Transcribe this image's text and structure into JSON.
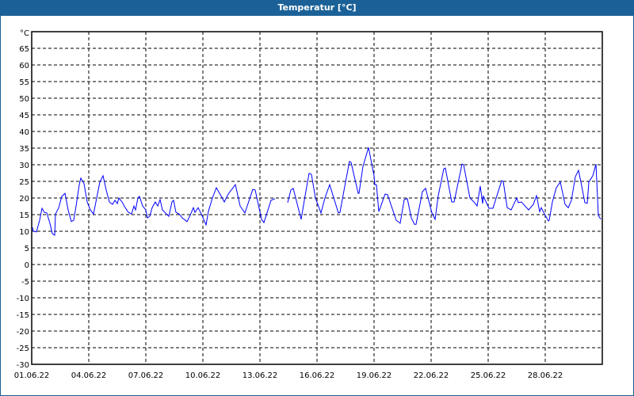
{
  "window": {
    "title": "Temperatur [°C]"
  },
  "chart_data": {
    "type": "line",
    "title": "Temperatur [°C]",
    "ylabel": "°C",
    "xlabel": "",
    "ylim": [
      -30,
      70
    ],
    "y_ticks": [
      -30,
      -25,
      -20,
      -15,
      -10,
      -5,
      0,
      5,
      10,
      15,
      20,
      25,
      30,
      35,
      40,
      45,
      50,
      55,
      60,
      65
    ],
    "x_unit": "hours since 01.06.22 00:00",
    "xlim": [
      0,
      720
    ],
    "x_ticks": [
      {
        "hour": 0,
        "label": "01.06.22"
      },
      {
        "hour": 72,
        "label": "04.06.22"
      },
      {
        "hour": 144,
        "label": "07.06.22"
      },
      {
        "hour": 216,
        "label": "10.06.22"
      },
      {
        "hour": 288,
        "label": "13.06.22"
      },
      {
        "hour": 360,
        "label": "16.06.22"
      },
      {
        "hour": 432,
        "label": "19.06.22"
      },
      {
        "hour": 504,
        "label": "22.06.22"
      },
      {
        "hour": 576,
        "label": "25.06.22"
      },
      {
        "hour": 648,
        "label": "28.06.22"
      }
    ],
    "grid": true,
    "line_color": "#0000ff",
    "series": [
      {
        "name": "Temperatur",
        "segments": [
          [
            [
              1,
              11.2
            ],
            [
              2,
              10.0
            ],
            [
              6,
              9.8
            ],
            [
              10,
              13.3
            ],
            [
              13,
              16.9
            ],
            [
              16,
              15.7
            ],
            [
              19,
              15.5
            ],
            [
              23,
              12.4
            ],
            [
              26,
              9.3
            ],
            [
              29,
              8.8
            ],
            [
              30,
              15.2
            ],
            [
              34,
              17.0
            ],
            [
              38,
              20.5
            ],
            [
              42,
              21.4
            ],
            [
              46,
              16.4
            ],
            [
              50,
              12.9
            ],
            [
              53,
              13.3
            ],
            [
              56,
              17.6
            ],
            [
              60,
              24.0
            ],
            [
              62,
              26.0
            ],
            [
              66,
              24.3
            ],
            [
              70,
              18.8
            ],
            [
              74,
              16.4
            ],
            [
              78,
              15.2
            ],
            [
              82,
              20.0
            ],
            [
              86,
              24.8
            ],
            [
              90,
              26.7
            ],
            [
              94,
              22.4
            ],
            [
              98,
              18.8
            ],
            [
              102,
              18.1
            ],
            [
              105,
              19.3
            ],
            [
              108,
              18.3
            ],
            [
              110,
              20.0
            ],
            [
              114,
              18.8
            ],
            [
              118,
              17.1
            ],
            [
              122,
              15.7
            ],
            [
              126,
              15.2
            ],
            [
              129,
              17.6
            ],
            [
              131,
              16.4
            ],
            [
              134,
              20.0
            ],
            [
              136,
              20.5
            ],
            [
              140,
              17.6
            ],
            [
              144,
              16.4
            ],
            [
              146,
              14.0
            ],
            [
              149,
              14.5
            ],
            [
              152,
              17.1
            ],
            [
              156,
              18.8
            ],
            [
              159,
              17.6
            ],
            [
              162,
              19.5
            ],
            [
              165,
              16.4
            ],
            [
              170,
              15.2
            ],
            [
              173,
              14.5
            ],
            [
              177,
              18.8
            ],
            [
              179,
              19.3
            ],
            [
              182,
              15.7
            ],
            [
              186,
              15.2
            ],
            [
              190,
              14.0
            ],
            [
              196,
              12.9
            ],
            [
              200,
              14.8
            ],
            [
              204,
              17.1
            ],
            [
              206,
              15.7
            ],
            [
              210,
              17.1
            ],
            [
              214,
              15.2
            ],
            [
              217,
              13.6
            ],
            [
              220,
              11.9
            ],
            [
              223,
              16.0
            ],
            [
              228,
              20.0
            ],
            [
              233,
              23.1
            ],
            [
              240,
              20.2
            ],
            [
              243,
              18.8
            ],
            [
              248,
              21.2
            ],
            [
              257,
              24.0
            ],
            [
              263,
              17.6
            ],
            [
              269,
              15.5
            ],
            [
              279,
              22.6
            ],
            [
              282,
              22.4
            ],
            [
              290,
              13.6
            ],
            [
              293,
              12.6
            ],
            [
              302,
              19.3
            ],
            [
              307,
              19.8
            ]
          ],
          [
            [
              323,
              18.6
            ],
            [
              327,
              22.4
            ],
            [
              330,
              22.9
            ],
            [
              340,
              13.6
            ],
            [
              345,
              20.7
            ],
            [
              350,
              27.4
            ],
            [
              353,
              27.1
            ],
            [
              358,
              20.0
            ],
            [
              365,
              15.5
            ],
            [
              370,
              20.0
            ],
            [
              376,
              24.0
            ],
            [
              387,
              15.5
            ],
            [
              389,
              15.7
            ],
            [
              396,
              24.8
            ],
            [
              401,
              31.0
            ],
            [
              403,
              30.7
            ],
            [
              412,
              21.4
            ],
            [
              413,
              21.4
            ],
            [
              418,
              29.5
            ],
            [
              425,
              35.2
            ],
            [
              432,
              26.7
            ],
            [
              433,
              24.0
            ],
            [
              435,
              24.0
            ],
            [
              438,
              15.9
            ],
            [
              446,
              21.2
            ],
            [
              449,
              21.0
            ],
            [
              460,
              13.3
            ],
            [
              465,
              12.4
            ],
            [
              470,
              19.5
            ],
            [
              474,
              19.8
            ],
            [
              479,
              14.0
            ],
            [
              483,
              12.1
            ],
            [
              485,
              12.1
            ],
            [
              493,
              21.9
            ],
            [
              497,
              22.9
            ],
            [
              505,
              15.5
            ],
            [
              509,
              13.6
            ],
            [
              513,
              20.7
            ],
            [
              520,
              28.8
            ],
            [
              522,
              29.0
            ],
            [
              530,
              18.8
            ],
            [
              533,
              18.8
            ],
            [
              543,
              30.2
            ],
            [
              545,
              30.0
            ],
            [
              553,
              20.0
            ],
            [
              558,
              18.8
            ],
            [
              562,
              17.6
            ],
            [
              566,
              23.6
            ],
            [
              569,
              18.3
            ],
            [
              570,
              20.5
            ],
            [
              577,
              16.9
            ],
            [
              582,
              16.9
            ],
            [
              593,
              25.2
            ],
            [
              595,
              25.0
            ],
            [
              600,
              17.1
            ],
            [
              605,
              16.4
            ],
            [
              612,
              20.0
            ],
            [
              614,
              18.6
            ],
            [
              618,
              18.8
            ],
            [
              627,
              16.4
            ],
            [
              633,
              18.1
            ],
            [
              637,
              20.7
            ],
            [
              641,
              15.9
            ],
            [
              643,
              17.1
            ],
            [
              647,
              15.2
            ],
            [
              652,
              13.1
            ],
            [
              653,
              13.3
            ],
            [
              657,
              18.8
            ],
            [
              662,
              23.1
            ],
            [
              667,
              24.8
            ],
            [
              673,
              18.1
            ],
            [
              677,
              17.1
            ],
            [
              681,
              19.3
            ],
            [
              686,
              26.4
            ],
            [
              690,
              28.3
            ],
            [
              694,
              23.6
            ],
            [
              698,
              18.6
            ],
            [
              701,
              18.4
            ],
            [
              703,
              24.8
            ],
            [
              708,
              26.7
            ],
            [
              712,
              30.2
            ],
            [
              715,
              14.8
            ],
            [
              718,
              13.6
            ]
          ]
        ]
      }
    ]
  }
}
